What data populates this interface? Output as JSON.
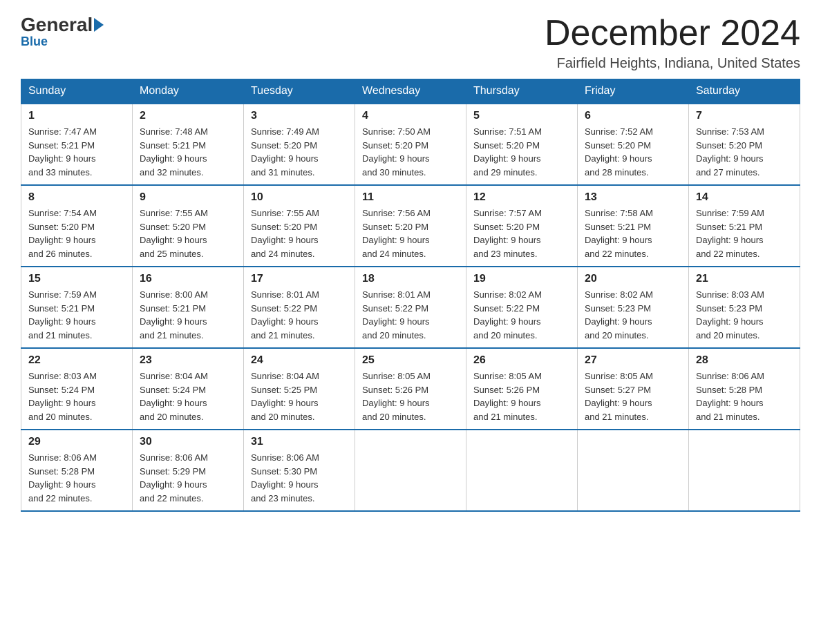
{
  "logo": {
    "general": "General",
    "blue": "Blue"
  },
  "header": {
    "title": "December 2024",
    "location": "Fairfield Heights, Indiana, United States"
  },
  "weekdays": [
    "Sunday",
    "Monday",
    "Tuesday",
    "Wednesday",
    "Thursday",
    "Friday",
    "Saturday"
  ],
  "weeks": [
    [
      {
        "day": "1",
        "sunrise": "7:47 AM",
        "sunset": "5:21 PM",
        "daylight": "9 hours and 33 minutes."
      },
      {
        "day": "2",
        "sunrise": "7:48 AM",
        "sunset": "5:21 PM",
        "daylight": "9 hours and 32 minutes."
      },
      {
        "day": "3",
        "sunrise": "7:49 AM",
        "sunset": "5:20 PM",
        "daylight": "9 hours and 31 minutes."
      },
      {
        "day": "4",
        "sunrise": "7:50 AM",
        "sunset": "5:20 PM",
        "daylight": "9 hours and 30 minutes."
      },
      {
        "day": "5",
        "sunrise": "7:51 AM",
        "sunset": "5:20 PM",
        "daylight": "9 hours and 29 minutes."
      },
      {
        "day": "6",
        "sunrise": "7:52 AM",
        "sunset": "5:20 PM",
        "daylight": "9 hours and 28 minutes."
      },
      {
        "day": "7",
        "sunrise": "7:53 AM",
        "sunset": "5:20 PM",
        "daylight": "9 hours and 27 minutes."
      }
    ],
    [
      {
        "day": "8",
        "sunrise": "7:54 AM",
        "sunset": "5:20 PM",
        "daylight": "9 hours and 26 minutes."
      },
      {
        "day": "9",
        "sunrise": "7:55 AM",
        "sunset": "5:20 PM",
        "daylight": "9 hours and 25 minutes."
      },
      {
        "day": "10",
        "sunrise": "7:55 AM",
        "sunset": "5:20 PM",
        "daylight": "9 hours and 24 minutes."
      },
      {
        "day": "11",
        "sunrise": "7:56 AM",
        "sunset": "5:20 PM",
        "daylight": "9 hours and 24 minutes."
      },
      {
        "day": "12",
        "sunrise": "7:57 AM",
        "sunset": "5:20 PM",
        "daylight": "9 hours and 23 minutes."
      },
      {
        "day": "13",
        "sunrise": "7:58 AM",
        "sunset": "5:21 PM",
        "daylight": "9 hours and 22 minutes."
      },
      {
        "day": "14",
        "sunrise": "7:59 AM",
        "sunset": "5:21 PM",
        "daylight": "9 hours and 22 minutes."
      }
    ],
    [
      {
        "day": "15",
        "sunrise": "7:59 AM",
        "sunset": "5:21 PM",
        "daylight": "9 hours and 21 minutes."
      },
      {
        "day": "16",
        "sunrise": "8:00 AM",
        "sunset": "5:21 PM",
        "daylight": "9 hours and 21 minutes."
      },
      {
        "day": "17",
        "sunrise": "8:01 AM",
        "sunset": "5:22 PM",
        "daylight": "9 hours and 21 minutes."
      },
      {
        "day": "18",
        "sunrise": "8:01 AM",
        "sunset": "5:22 PM",
        "daylight": "9 hours and 20 minutes."
      },
      {
        "day": "19",
        "sunrise": "8:02 AM",
        "sunset": "5:22 PM",
        "daylight": "9 hours and 20 minutes."
      },
      {
        "day": "20",
        "sunrise": "8:02 AM",
        "sunset": "5:23 PM",
        "daylight": "9 hours and 20 minutes."
      },
      {
        "day": "21",
        "sunrise": "8:03 AM",
        "sunset": "5:23 PM",
        "daylight": "9 hours and 20 minutes."
      }
    ],
    [
      {
        "day": "22",
        "sunrise": "8:03 AM",
        "sunset": "5:24 PM",
        "daylight": "9 hours and 20 minutes."
      },
      {
        "day": "23",
        "sunrise": "8:04 AM",
        "sunset": "5:24 PM",
        "daylight": "9 hours and 20 minutes."
      },
      {
        "day": "24",
        "sunrise": "8:04 AM",
        "sunset": "5:25 PM",
        "daylight": "9 hours and 20 minutes."
      },
      {
        "day": "25",
        "sunrise": "8:05 AM",
        "sunset": "5:26 PM",
        "daylight": "9 hours and 20 minutes."
      },
      {
        "day": "26",
        "sunrise": "8:05 AM",
        "sunset": "5:26 PM",
        "daylight": "9 hours and 21 minutes."
      },
      {
        "day": "27",
        "sunrise": "8:05 AM",
        "sunset": "5:27 PM",
        "daylight": "9 hours and 21 minutes."
      },
      {
        "day": "28",
        "sunrise": "8:06 AM",
        "sunset": "5:28 PM",
        "daylight": "9 hours and 21 minutes."
      }
    ],
    [
      {
        "day": "29",
        "sunrise": "8:06 AM",
        "sunset": "5:28 PM",
        "daylight": "9 hours and 22 minutes."
      },
      {
        "day": "30",
        "sunrise": "8:06 AM",
        "sunset": "5:29 PM",
        "daylight": "9 hours and 22 minutes."
      },
      {
        "day": "31",
        "sunrise": "8:06 AM",
        "sunset": "5:30 PM",
        "daylight": "9 hours and 23 minutes."
      },
      null,
      null,
      null,
      null
    ]
  ],
  "labels": {
    "sunrise": "Sunrise:",
    "sunset": "Sunset:",
    "daylight": "Daylight:"
  }
}
